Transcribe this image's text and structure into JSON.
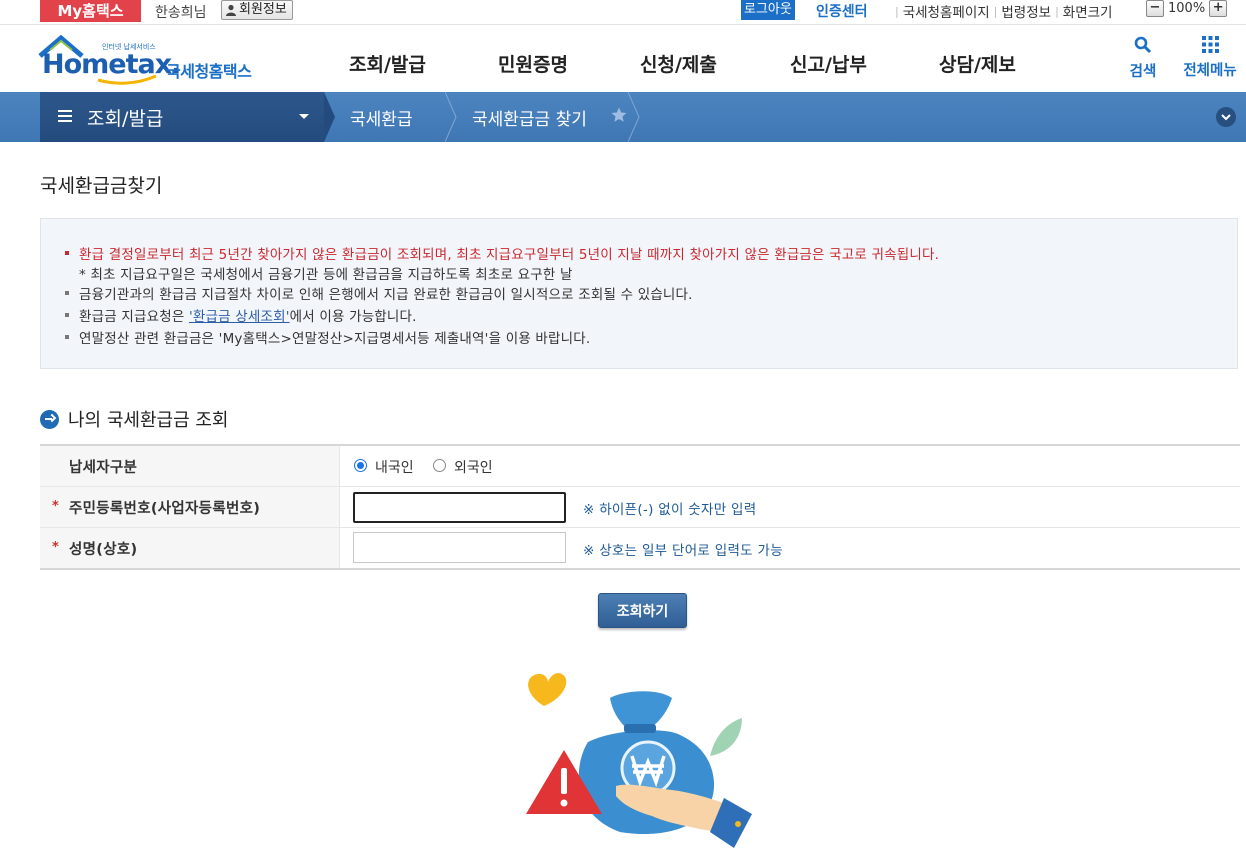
{
  "util": {
    "my_hometax": "My홈택스",
    "user_name": "한송희님",
    "member_info": "회원정보",
    "logout": "로그아웃",
    "cert_center": "인증센터",
    "links": [
      "국세청홈페이지",
      "법령정보",
      "화면크기"
    ],
    "zoom_minus": "−",
    "zoom_value": "100%",
    "zoom_plus": "+"
  },
  "header": {
    "logo_tagline": "인터넷 납세서비스",
    "logo_text": "Hometax.",
    "logo_kor": "국세청홈택스",
    "nav": [
      "조회/발급",
      "민원증명",
      "신청/제출",
      "신고/납부",
      "상담/제보"
    ],
    "search_label": "검색",
    "all_menu_label": "전체메뉴"
  },
  "location": {
    "main": "조회/발급",
    "crumbs": [
      "국세환급",
      "국세환급금 찾기"
    ]
  },
  "page": {
    "title": "국세환급금찾기",
    "notices": {
      "n1": "환급 결정일로부터 최근 5년간 찾아가지 않은 환급금이 조회되며, 최초 지급요구일부터 5년이 지날 때까지 찾아가지 않은 환급금은 국고로 귀속됩니다.",
      "n1_sub": "* 최초 지급요구일은 국세청에서 금융기관 등에 환급금을 지급하도록 최초로 요구한 날",
      "n2": "금융기관과의 환급금 지급절차 차이로 인해 은행에서 지급 완료한 환급금이 일시적으로 조회될 수 있습니다.",
      "n3_pre": "환급금 지급요청은 ",
      "n3_link": "'환급금 상세조회'",
      "n3_post": "에서 이용 가능합니다.",
      "n4": "연말정산 관련 환급금은 'My홈택스>연말정산>지급명세서등 제출내역'을 이용 바랍니다."
    },
    "section_title": "나의 국세환급금 조회",
    "form": {
      "taxpayer_type_label": "납세자구분",
      "domestic": "내국인",
      "foreigner": "외국인",
      "rrn_label": "주민등록번호(사업자등록번호)",
      "rrn_value": "",
      "rrn_hint": "※ 하이픈(-) 없이 숫자만 입력",
      "name_label": "성명(상호)",
      "name_value": "",
      "name_hint": "※ 상호는 일부 단어로 입력도 가능",
      "required_mark": "*"
    },
    "search_button": "조회하기"
  },
  "colors": {
    "brand_blue": "#1c6fc7",
    "my_red": "#e2424a",
    "notice_red": "#c9292f",
    "loc_bar": "#4c84c0",
    "loc_main": "#244b7d"
  }
}
